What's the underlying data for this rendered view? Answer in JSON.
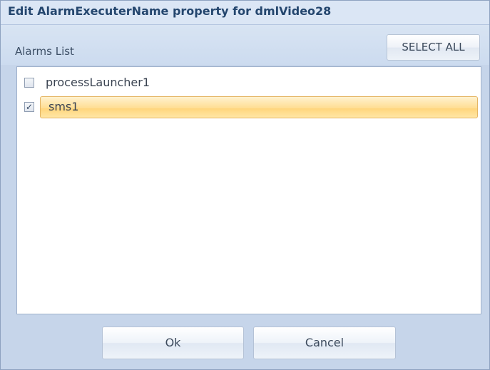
{
  "dialog": {
    "title": "Edit AlarmExecuterName property for dmlVideo28"
  },
  "alarms_list": {
    "label": "Alarms List",
    "select_all_label": "SELECT ALL",
    "items": [
      {
        "label": "processLauncher1",
        "checked": false,
        "selected": false
      },
      {
        "label": "sms1",
        "checked": true,
        "selected": true
      }
    ]
  },
  "buttons": {
    "ok_label": "Ok",
    "cancel_label": "Cancel"
  },
  "colors": {
    "selection_highlight": "#ffdd92",
    "title_text": "#24466e",
    "window_background": "#c6d5ea"
  },
  "icons": {
    "checked": "checkbox-checked-icon",
    "unchecked": "checkbox-unchecked-icon"
  }
}
